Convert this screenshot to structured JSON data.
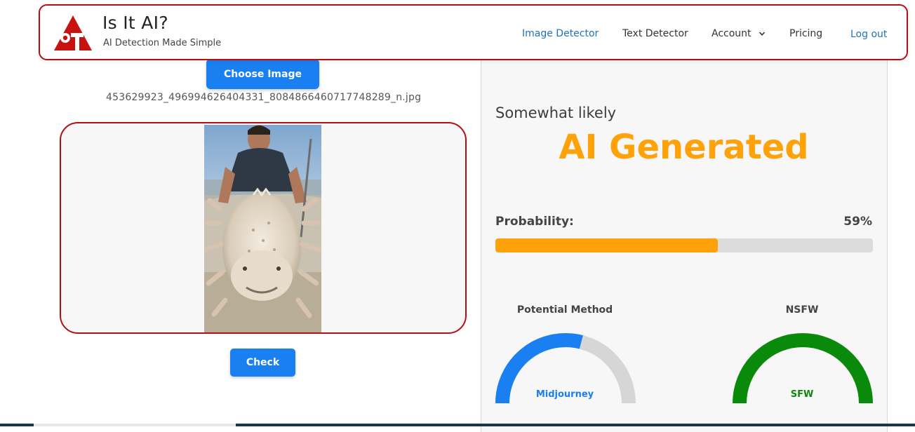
{
  "header": {
    "brand_title": "Is It AI?",
    "brand_subtitle": "AI Detection Made Simple",
    "nav": {
      "image_detector": "Image Detector",
      "text_detector": "Text Detector",
      "account": "Account",
      "pricing": "Pricing",
      "logout": "Log out"
    },
    "logo_icon": "red-triangle-eye-logo",
    "account_chevron_icon": "chevron-down-icon"
  },
  "upload": {
    "choose_label": "Choose Image",
    "filename": "453629923_496994626404331_8084866460717748289_n.jpg",
    "check_label": "Check"
  },
  "result": {
    "likelihood": "Somewhat likely",
    "verdict": "AI Generated",
    "probability_label": "Probability:",
    "probability_value": "59%",
    "probability_fraction": 0.59,
    "method": {
      "title": "Potential Method",
      "value": "Midjourney",
      "gauge_fraction": 0.58
    },
    "nsfw": {
      "title": "NSFW",
      "value": "SFW",
      "gauge_fraction": 1.0
    }
  },
  "colors": {
    "accent_blue": "#1a7ff0",
    "brand_red": "#b40f14",
    "verdict_orange": "#ffa20a",
    "sfw_green": "#0a8a0a",
    "gauge_track": "#d6d6d6"
  }
}
